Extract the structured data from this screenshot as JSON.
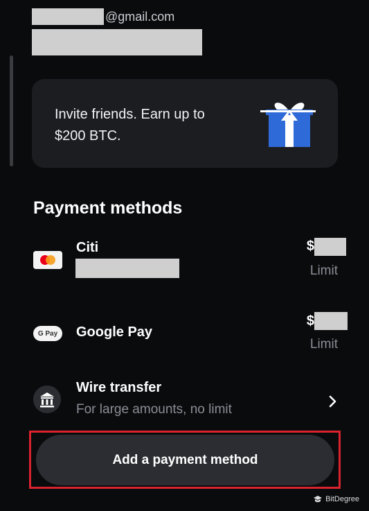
{
  "account": {
    "email_suffix": "@gmail.com"
  },
  "invite": {
    "line1": "Invite friends. Earn up to",
    "line2": "$200 BTC.",
    "icon": "gift-icon",
    "colors": {
      "box": "#2f6bd8",
      "ribbon": "#ffffff"
    }
  },
  "payment_methods": {
    "title": "Payment methods",
    "items": [
      {
        "name": "Citi",
        "currency_prefix": "$",
        "limit_label": "Limit",
        "icon": "mastercard-icon"
      },
      {
        "name": "Google Pay",
        "currency_prefix": "$",
        "limit_label": "Limit",
        "icon": "google-pay-icon",
        "icon_text": "G Pay"
      },
      {
        "name": "Wire transfer",
        "subtitle": "For large amounts, no limit",
        "icon": "bank-icon"
      }
    ]
  },
  "actions": {
    "add_label": "Add a payment method",
    "highlight_color": "#d9232e"
  },
  "watermark": {
    "text": "BitDegree"
  }
}
